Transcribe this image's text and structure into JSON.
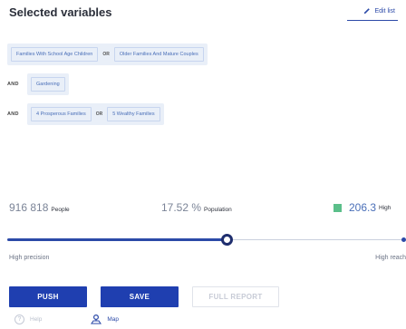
{
  "header": {
    "title": "Selected variables",
    "edit_label": "Edit list"
  },
  "conditions": {
    "rows": [
      {
        "operator": "",
        "chips": [
          "Families With School Age Children",
          "Older Families And Mature Couples"
        ],
        "join": "OR"
      },
      {
        "operator": "AND",
        "chips": [
          "Gardening"
        ],
        "join": ""
      },
      {
        "operator": "AND",
        "chips": [
          "4 Prosperous Families",
          "5 Wealthy Families"
        ],
        "join": "OR"
      }
    ]
  },
  "stats": {
    "people_value": "916 818",
    "people_unit": "People",
    "population_value": "17.52 %",
    "population_unit": "Population",
    "high_value": "206.3",
    "high_unit": "High"
  },
  "slider": {
    "position_fraction": 0.55,
    "left_label": "High precision",
    "right_label": "High reach"
  },
  "buttons": {
    "push": "PUSH",
    "save": "SAVE",
    "full_report": "FULL REPORT"
  },
  "footer": {
    "help": "Help",
    "help_glyph": "?",
    "map": "Map"
  },
  "colors": {
    "accent": "#1f3fb0",
    "chip_bg": "#e9eff8",
    "high_indicator": "#5bbf8a"
  }
}
